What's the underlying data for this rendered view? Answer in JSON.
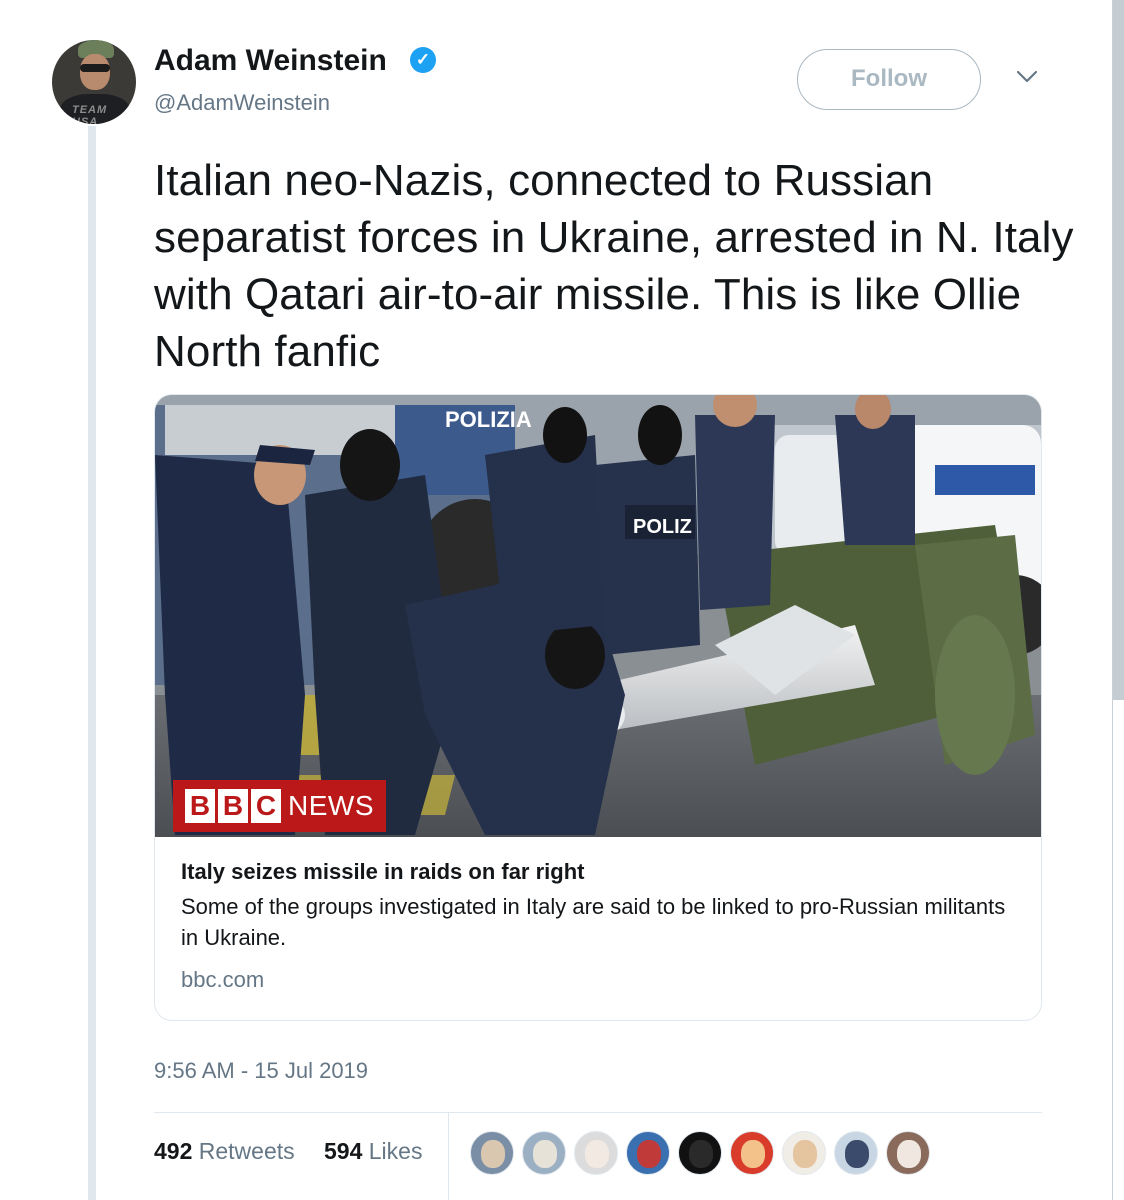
{
  "author": {
    "display_name": "Adam Weinstein",
    "handle": "@AdamWeinstein",
    "verified": true,
    "avatar_shirt_text": "TEAM USA"
  },
  "header": {
    "follow_label": "Follow"
  },
  "tweet": {
    "text": "Italian neo-Nazis, connected to Russian separatist forces in Ukraine, arrested in N. Italy with Qatari air-to-air missile. This is like Ollie North fanfic",
    "timestamp": "9:56 AM - 15 Jul 2019"
  },
  "card": {
    "image_logo_letters": [
      "B",
      "B",
      "C"
    ],
    "image_logo_word": "NEWS",
    "image_vehicle_text": "POLIZIA",
    "title": "Italy seizes missile in raids on far right",
    "description": "Some of the groups investigated in Italy are said to be linked to pro-Russian militants in Ukraine.",
    "domain": "bbc.com"
  },
  "stats": {
    "retweets_count": "492",
    "retweets_label": "Retweets",
    "likes_count": "594",
    "likes_label": "Likes"
  },
  "likers": [
    {
      "name": "liker-1",
      "bg": "#7a8fa6",
      "fg": "#d9c7b0"
    },
    {
      "name": "liker-2",
      "bg": "#9cb0c4",
      "fg": "#e6e2d8"
    },
    {
      "name": "liker-3",
      "bg": "#dcdcdc",
      "fg": "#f2e9e2"
    },
    {
      "name": "liker-4",
      "bg": "#3a6fb0",
      "fg": "#c03a3a"
    },
    {
      "name": "liker-5",
      "bg": "#111111",
      "fg": "#2a2a2a"
    },
    {
      "name": "liker-6",
      "bg": "#d93c2a",
      "fg": "#f3c28a"
    },
    {
      "name": "liker-7",
      "bg": "#f0ece6",
      "fg": "#e5c4a0"
    },
    {
      "name": "liker-8",
      "bg": "#c8d6e4",
      "fg": "#3b4b6b"
    },
    {
      "name": "liker-9",
      "bg": "#8a6a5a",
      "fg": "#f0e8e0"
    }
  ],
  "colors": {
    "accent": "#1da1f2",
    "muted": "#657786",
    "border": "#e1e8ed",
    "bbc_red": "#bb1919"
  }
}
